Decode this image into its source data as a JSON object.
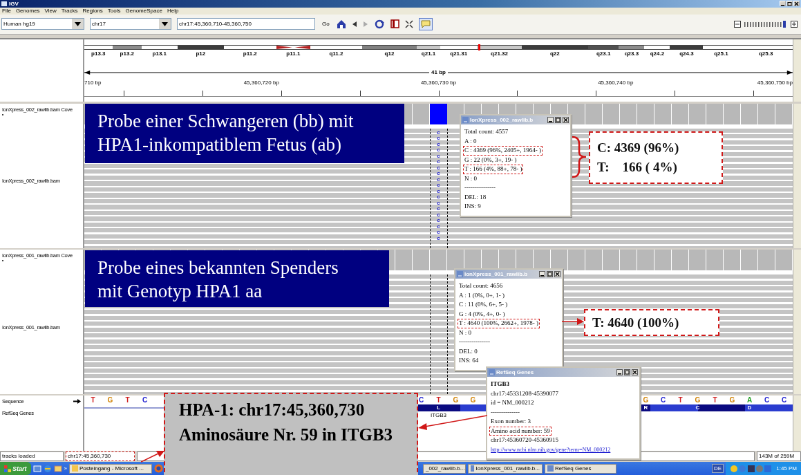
{
  "window": {
    "title": "IGV"
  },
  "menu": [
    "File",
    "Genomes",
    "View",
    "Tracks",
    "Regions",
    "Tools",
    "GenomeSpace",
    "Help"
  ],
  "toolbar": {
    "genome": "Human hg19",
    "chromosome": "chr17",
    "locus": "chr17:45,360,710-45,360,750",
    "go": "Go",
    "popup_mode_selected": true,
    "zoom": {
      "level": 0.95
    }
  },
  "ideogram": [
    {
      "label": "p13.3",
      "color": "#ffffff",
      "kind": "band"
    },
    {
      "label": "p13.2",
      "color": "#8c8c8c",
      "kind": "band"
    },
    {
      "label": "p13.1",
      "color": "#ffffff",
      "kind": "band"
    },
    {
      "label": "p12",
      "color": "#3c3c3c",
      "kind": "band"
    },
    {
      "label": "p11.2",
      "color": "#ffffff",
      "kind": "band"
    },
    {
      "label": "p11.1",
      "color": "#b41e1e",
      "kind": "centromere"
    },
    {
      "label": "q11.2",
      "color": "#ffffff",
      "kind": "band"
    },
    {
      "label": "q12",
      "color": "#808080",
      "kind": "band"
    },
    {
      "label": "q21.1",
      "color": "#c8c8c8",
      "kind": "band"
    },
    {
      "label": "q21.31",
      "color": "#ffffff",
      "kind": "band"
    },
    {
      "label": "q21.32",
      "color": "#c8c8c8",
      "kind": "current"
    },
    {
      "label": "q22",
      "color": "#3c3c3c",
      "kind": "band"
    },
    {
      "label": "q23.1",
      "color": "#505050",
      "kind": "band"
    },
    {
      "label": "q23.3",
      "color": "#8c8c8c",
      "kind": "band"
    },
    {
      "label": "q24.2",
      "color": "#ffffff",
      "kind": "band"
    },
    {
      "label": "q24.3",
      "color": "#3c3c3c",
      "kind": "band"
    },
    {
      "label": "q25.1",
      "color": "#ffffff",
      "kind": "band"
    },
    {
      "label": "q25.3",
      "color": "#ffffff",
      "kind": "band"
    }
  ],
  "ruler": {
    "span": "41 bp",
    "ticks": [
      "710 bp",
      "45,360,720 bp",
      "45,360,730 bp",
      "45,360,740 bp",
      "45,360,750 bp"
    ]
  },
  "tracks": [
    {
      "coverage_name": "IonXpress_002_rawlib.bam Cove",
      "name": "IonXpress_002_rawlib.bam",
      "mismatch": true,
      "read_bases": [
        "c",
        "c",
        "c",
        "c",
        "c",
        "c",
        "c",
        "c",
        "c",
        "c",
        "c",
        "c",
        "c",
        "c",
        "c",
        "c",
        "c",
        "c",
        "c"
      ]
    },
    {
      "coverage_name": "IonXpress_001_rawlib.bam Cove",
      "name": "IonXpress_001_rawlib.bam",
      "mismatch": false
    }
  ],
  "sequence_track": {
    "name": "Sequence",
    "genes_name": "RefSeq Genes",
    "gene": "ITGB3",
    "bases": [
      {
        "base": "T",
        "color": "#d02020"
      },
      {
        "base": "G",
        "color": "#d08000"
      },
      {
        "base": "T",
        "color": "#d02020"
      },
      {
        "base": "C",
        "color": "#2020d0"
      },
      {
        "base": "C",
        "color": "#2020d0"
      },
      {
        "base": "T",
        "color": "#d02020"
      },
      {
        "base": "G",
        "color": "#d08000"
      },
      {
        "base": "G",
        "color": "#d08000"
      },
      {
        "base": "G",
        "color": "#d08000"
      },
      {
        "base": "C",
        "color": "#2020d0"
      },
      {
        "base": "T",
        "color": "#d02020"
      },
      {
        "base": "G",
        "color": "#d08000"
      },
      {
        "base": "T",
        "color": "#d02020"
      },
      {
        "base": "G",
        "color": "#d08000"
      },
      {
        "base": "A",
        "color": "#20a020"
      },
      {
        "base": "C",
        "color": "#2020d0"
      },
      {
        "base": "C",
        "color": "#2020d0"
      }
    ],
    "amino_acids": [
      "L",
      "R",
      "C",
      "D"
    ]
  },
  "popups": [
    {
      "title": "IonXpress_002_rawlib.b",
      "lines": [
        {
          "text": "Total count: 4557",
          "highlighted": false
        },
        {
          "text": "A : 0",
          "highlighted": false
        },
        {
          "text": "C : 4369 (96%, 2405+, 1964- )",
          "highlighted": true
        },
        {
          "text": "G : 22 (0%, 3+, 19- )",
          "highlighted": false
        },
        {
          "text": "T : 166 (4%, 88+, 78- )",
          "highlighted": true
        },
        {
          "text": "N : 0",
          "highlighted": false
        },
        {
          "text": "---------------",
          "highlighted": false
        },
        {
          "text": "DEL: 18",
          "highlighted": false
        },
        {
          "text": "INS: 9",
          "highlighted": false
        }
      ]
    },
    {
      "title": "IonXpress_001_rawlib.b",
      "lines": [
        {
          "text": "Total count: 4656",
          "highlighted": false
        },
        {
          "text": "A : 1 (0%, 0+, 1- )",
          "highlighted": false
        },
        {
          "text": "C : 11 (0%, 6+, 5- )",
          "highlighted": false
        },
        {
          "text": "G : 4 (0%, 4+, 0- )",
          "highlighted": false
        },
        {
          "text": "T : 4640 (100%, 2662+, 1978- )",
          "highlighted": true
        },
        {
          "text": "N : 0",
          "highlighted": false
        },
        {
          "text": "---------------",
          "highlighted": false
        },
        {
          "text": "DEL: 0",
          "highlighted": false
        },
        {
          "text": "INS: 64",
          "highlighted": false
        }
      ]
    },
    {
      "title": "RefSeq Genes",
      "lines": [
        {
          "text": "ITGB3",
          "highlighted": false,
          "kind": "heading"
        },
        {
          "text": "chr17:45331208-45390077",
          "highlighted": false
        },
        {
          "text": "id = NM_000212",
          "highlighted": false
        },
        {
          "text": "--------------",
          "highlighted": false
        },
        {
          "text": "Exon number: 3",
          "highlighted": false
        },
        {
          "text": "Amino acid number: 59",
          "highlighted": true
        },
        {
          "text": "chr17:45360720-45360915",
          "highlighted": false
        },
        {
          "text": "http://www.ncbi.nlm.nih.gov/gene?term=NM_000212",
          "highlighted": false,
          "kind": "link"
        }
      ]
    }
  ],
  "annotations": {
    "sample_1": "Probe einer Schwangeren (bb) mit HPA1-inkompatiblem Fetus (ab)",
    "sample_1_counts": [
      "**C:** 4369 (96%)",
      "**T:**    166 ( 4%)"
    ],
    "sample_2": "Probe eines bekannten Spenders mit Genotyp HPA1 aa",
    "sample_2_counts": [
      "**T:** 4640 (100%)"
    ],
    "position": [
      "HPA-1: chr17:45,360,730",
      "Aminosäure Nr. 59 in ITGB3"
    ]
  },
  "status_bar": {
    "message": "tracks loaded",
    "locus": "chr17:45,360,730",
    "memory": "143M of 259M"
  },
  "taskbar": {
    "start": "Start",
    "more": "»",
    "items": [
      "Posteingang - Microsoft ...",
      "_002_rawlib.b...",
      "IonXpress_001_rawlib.b...",
      "RefSeq Genes"
    ],
    "language": "DE",
    "clock": "1:45 PM"
  }
}
